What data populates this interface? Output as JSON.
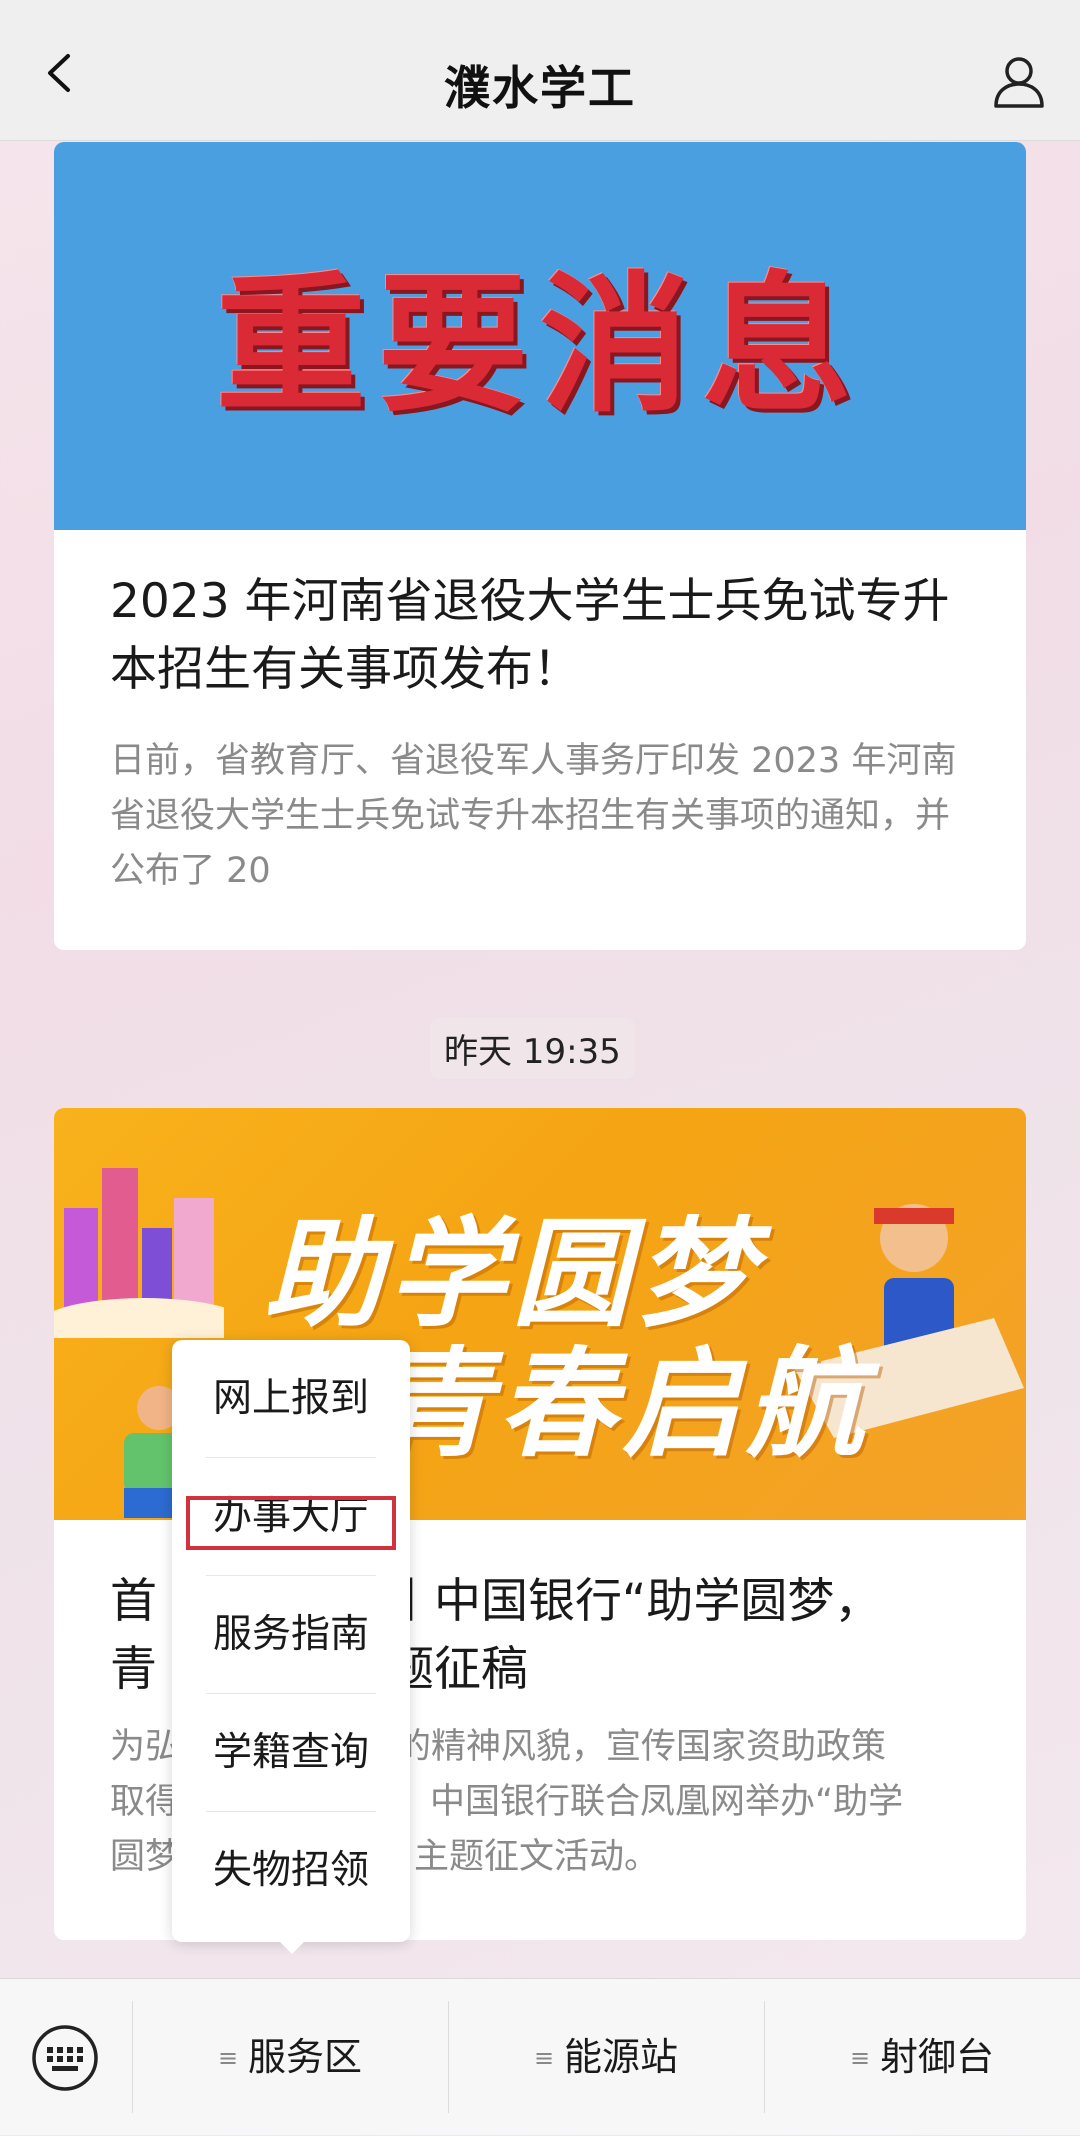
{
  "header": {
    "title": "濮水学工",
    "back_icon": "chevron-left-icon",
    "profile_icon": "user-icon"
  },
  "articles": [
    {
      "banner_text": "重要消息",
      "title": "2023 年河南省退役大学生士兵免试专升本招生有关事项发布！",
      "summary": "日前，省教育厅、省退役军人事务厅印发 2023 年河南省退役大学生士兵免试专升本招生有关事项的通知，并公布了 20"
    },
    {
      "banner_line1": "助学圆梦",
      "banner_line2": "青春启航",
      "title": "首",
      "title_visible": "丨中国银行“助学圆梦，",
      "title_line2": "青",
      "title_line2_visible": "题征稿",
      "summary_line1": "为弘",
      "summary_line1_visible": "的精神风貌，宣传国家资助政策",
      "summary_line2": "取得",
      "summary_line2_visible": "中国银行联合凤凰网举办“助学",
      "summary_line3": "圆梦",
      "summary_line3_visible": "主题征文活动。"
    }
  ],
  "timestamp": "昨天 19:35",
  "popup_menu": {
    "items": [
      "网上报到",
      "办事大厅",
      "服务指南",
      "学籍查询",
      "失物招领"
    ],
    "highlighted": "办事大厅"
  },
  "bottom_bar": {
    "keyboard_icon": "keyboard-icon",
    "menus": [
      "服务区",
      "能源站",
      "射御台"
    ],
    "menu_icon": "menu-lines-icon"
  },
  "colors": {
    "banner1_bg": "#4a9fe0",
    "banner1_text": "#d92a36",
    "banner2_bg": "#f5a413",
    "highlight_border": "#d0333d"
  }
}
